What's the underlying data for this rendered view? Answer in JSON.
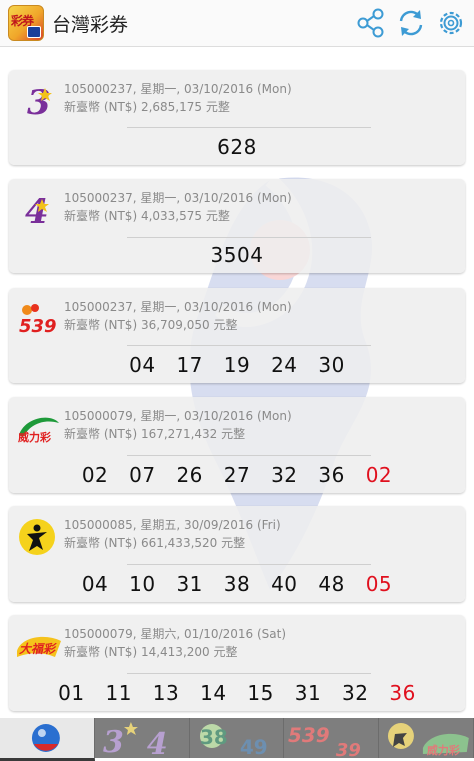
{
  "app": {
    "title": "台灣彩券",
    "logo_text": "彩券"
  },
  "header": {
    "icons": [
      "share-icon",
      "refresh-icon",
      "settings-icon"
    ]
  },
  "colors": {
    "special_number": "#e0101e",
    "meta_text": "#8a8a8a",
    "card_bg": "#eeeeee"
  },
  "draws": [
    {
      "game_icon": "3-star-logo",
      "period": "105000237",
      "date_line": "星期一, 03/10/2016 (Mon)",
      "prize_label": "新臺幣 (NT$)",
      "prize_amount": "2,685,175",
      "prize_unit": "元整",
      "numbers": [
        "628"
      ],
      "special": ""
    },
    {
      "game_icon": "4-star-logo",
      "period": "105000237",
      "date_line": "星期一, 03/10/2016 (Mon)",
      "prize_label": "新臺幣 (NT$)",
      "prize_amount": "4,033,575",
      "prize_unit": "元整",
      "numbers": [
        "3504"
      ],
      "special": ""
    },
    {
      "game_icon": "539-logo",
      "period": "105000237",
      "date_line": "星期一, 03/10/2016 (Mon)",
      "prize_label": "新臺幣 (NT$)",
      "prize_amount": "36,709,050",
      "prize_unit": "元整",
      "numbers": [
        "04",
        "17",
        "19",
        "24",
        "30"
      ],
      "special": ""
    },
    {
      "game_icon": "super-lotto-logo",
      "period": "105000079",
      "date_line": "星期一, 03/10/2016 (Mon)",
      "prize_label": "新臺幣 (NT$)",
      "prize_amount": "167,271,432",
      "prize_unit": "元整",
      "numbers": [
        "02",
        "07",
        "26",
        "27",
        "32",
        "36"
      ],
      "special": "02"
    },
    {
      "game_icon": "lotto-649-logo",
      "period": "105000085",
      "date_line": "星期五, 30/09/2016 (Fri)",
      "prize_label": "新臺幣 (NT$)",
      "prize_amount": "661,433,520",
      "prize_unit": "元整",
      "numbers": [
        "04",
        "10",
        "31",
        "38",
        "40",
        "48"
      ],
      "special": "05"
    },
    {
      "game_icon": "big-fortune-logo",
      "period": "105000079",
      "date_line": "星期六, 01/10/2016 (Sat)",
      "prize_label": "新臺幣 (NT$)",
      "prize_amount": "14,413,200",
      "prize_unit": "元整",
      "numbers": [
        "01",
        "11",
        "13",
        "14",
        "15",
        "31",
        "32"
      ],
      "special": "36"
    }
  ],
  "tabs": [
    {
      "icon": "lottery-ball-icon",
      "active": true
    },
    {
      "icon": "3-4-star-tab-icon",
      "active": false
    },
    {
      "icon": "38-49-tab-icon",
      "active": false
    },
    {
      "icon": "539-39-tab-icon",
      "active": false
    },
    {
      "icon": "lotto-super-tab-icon",
      "active": false
    }
  ]
}
